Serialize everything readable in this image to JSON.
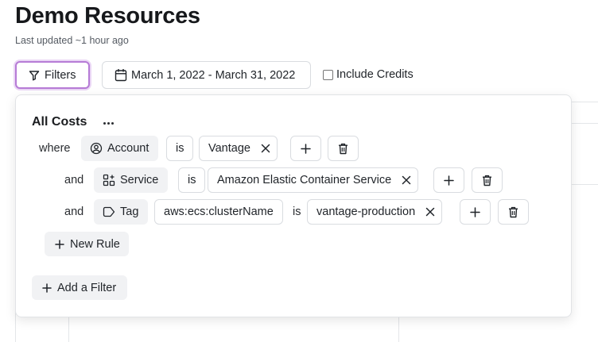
{
  "page": {
    "title": "Demo Resources",
    "subtitle": "Last updated ~1 hour ago"
  },
  "toolbar": {
    "filters_label": "Filters",
    "date_range": "March 1, 2022 - March 31, 2022",
    "include_credits_label": "Include Credits",
    "include_credits_checked": false
  },
  "filter_panel": {
    "title": "All Costs",
    "rules": [
      {
        "conjunction": "where",
        "field": "Account",
        "field_icon": "user-circle-icon",
        "operator": "is",
        "value": "Vantage"
      },
      {
        "conjunction": "and",
        "field": "Service",
        "field_icon": "grid-plus-icon",
        "operator": "is",
        "value": "Amazon Elastic Container Service"
      },
      {
        "conjunction": "and",
        "field": "Tag",
        "field_icon": "tag-icon",
        "tag_key": "aws:ecs:clusterName",
        "operator": "is",
        "value": "vantage-production"
      }
    ],
    "new_rule_label": "New Rule",
    "add_filter_label": "Add a Filter"
  },
  "colors": {
    "accent_focus": "#b67bd6",
    "chip_bg": "#f1f2f4",
    "border": "#d9dce0"
  }
}
